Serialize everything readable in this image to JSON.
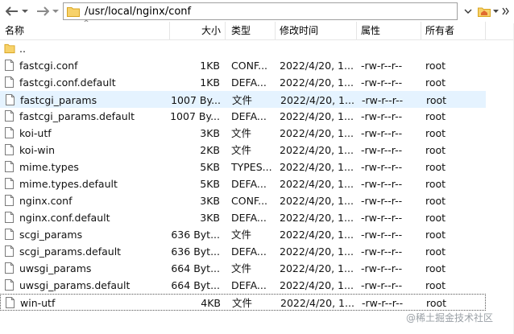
{
  "toolbar": {
    "path": "/usr/local/nginx/conf"
  },
  "columns": {
    "name": "名称",
    "size": "大小",
    "type": "类型",
    "mtime": "修改时间",
    "attr": "属性",
    "owner": "所有者"
  },
  "rows": [
    {
      "name": "..",
      "size": "",
      "type": "",
      "mtime": "",
      "attr": "",
      "owner": "",
      "kind": "folder"
    },
    {
      "name": "fastcgi.conf",
      "size": "1KB",
      "type": "CONF...",
      "mtime": "2022/4/20, 1...",
      "attr": "-rw-r--r--",
      "owner": "root",
      "kind": "file"
    },
    {
      "name": "fastcgi.conf.default",
      "size": "1KB",
      "type": "DEFA...",
      "mtime": "2022/4/20, 1...",
      "attr": "-rw-r--r--",
      "owner": "root",
      "kind": "file"
    },
    {
      "name": "fastcgi_params",
      "size": "1007 By...",
      "type": "文件",
      "mtime": "2022/4/20, 1...",
      "attr": "-rw-r--r--",
      "owner": "root",
      "kind": "file"
    },
    {
      "name": "fastcgi_params.default",
      "size": "1007 By...",
      "type": "DEFA...",
      "mtime": "2022/4/20, 1...",
      "attr": "-rw-r--r--",
      "owner": "root",
      "kind": "file"
    },
    {
      "name": "koi-utf",
      "size": "3KB",
      "type": "文件",
      "mtime": "2022/4/20, 1...",
      "attr": "-rw-r--r--",
      "owner": "root",
      "kind": "file"
    },
    {
      "name": "koi-win",
      "size": "2KB",
      "type": "文件",
      "mtime": "2022/4/20, 1...",
      "attr": "-rw-r--r--",
      "owner": "root",
      "kind": "file"
    },
    {
      "name": "mime.types",
      "size": "5KB",
      "type": "TYPES...",
      "mtime": "2022/4/20, 1...",
      "attr": "-rw-r--r--",
      "owner": "root",
      "kind": "file"
    },
    {
      "name": "mime.types.default",
      "size": "5KB",
      "type": "DEFA...",
      "mtime": "2022/4/20, 1...",
      "attr": "-rw-r--r--",
      "owner": "root",
      "kind": "file"
    },
    {
      "name": "nginx.conf",
      "size": "3KB",
      "type": "CONF...",
      "mtime": "2022/4/20, 1...",
      "attr": "-rw-r--r--",
      "owner": "root",
      "kind": "file"
    },
    {
      "name": "nginx.conf.default",
      "size": "3KB",
      "type": "DEFA...",
      "mtime": "2022/4/20, 1...",
      "attr": "-rw-r--r--",
      "owner": "root",
      "kind": "file"
    },
    {
      "name": "scgi_params",
      "size": "636 Byt...",
      "type": "文件",
      "mtime": "2022/4/20, 1...",
      "attr": "-rw-r--r--",
      "owner": "root",
      "kind": "file"
    },
    {
      "name": "scgi_params.default",
      "size": "636 Byt...",
      "type": "DEFA...",
      "mtime": "2022/4/20, 1...",
      "attr": "-rw-r--r--",
      "owner": "root",
      "kind": "file"
    },
    {
      "name": "uwsgi_params",
      "size": "664 Byt...",
      "type": "文件",
      "mtime": "2022/4/20, 1...",
      "attr": "-rw-r--r--",
      "owner": "root",
      "kind": "file"
    },
    {
      "name": "uwsgi_params.default",
      "size": "664 Byt...",
      "type": "DEFA...",
      "mtime": "2022/4/20, 1...",
      "attr": "-rw-r--r--",
      "owner": "root",
      "kind": "file"
    },
    {
      "name": "win-utf",
      "size": "4KB",
      "type": "文件",
      "mtime": "2022/4/20, 1...",
      "attr": "-rw-r--r--",
      "owner": "root",
      "kind": "file"
    }
  ],
  "selected_row": "fastcgi_params",
  "focused_row": "win-utf",
  "watermark": "@稀土掘金技术社区",
  "colors": {
    "selection": "#e5f3ff",
    "folder": "#f5c542",
    "header_separator": "#e5e5e5"
  }
}
